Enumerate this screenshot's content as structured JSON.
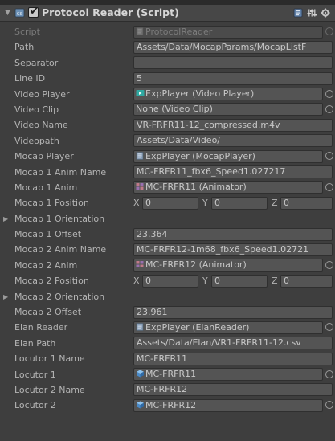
{
  "component": {
    "title": "Protocol Reader (Script)",
    "enabled": true
  },
  "icons": {
    "fold": "triangle-down-icon",
    "script": "script-icon",
    "checkbox": "checkbox-checked-icon",
    "help": "help-book-icon",
    "preset": "preset-icon",
    "settings": "gear-icon",
    "selector": "object-picker-icon",
    "video_component": "video-player-component-icon",
    "script_asset": "script-asset-icon",
    "animator": "animator-icon",
    "gameobject": "gameobject-cube-icon"
  },
  "rows": {
    "script": {
      "label": "Script",
      "value": "ProtocolReader"
    },
    "path": {
      "label": "Path",
      "value": "Assets/Data/MocapParams/MocapListF"
    },
    "separator": {
      "label": "Separator",
      "value": ""
    },
    "line_id": {
      "label": "Line ID",
      "value": "5"
    },
    "video_player": {
      "label": "Video Player",
      "value": "ExpPlayer (Video Player)"
    },
    "video_clip": {
      "label": "Video Clip",
      "value": "None (Video Clip)"
    },
    "video_name": {
      "label": "Video Name",
      "value": "VR-FRFR11-12_compressed.m4v"
    },
    "videopath": {
      "label": "Videopath",
      "value": "Assets/Data/Video/"
    },
    "mocap_player": {
      "label": "Mocap Player",
      "value": "ExpPlayer (MocapPlayer)"
    },
    "mocap1_anim_name": {
      "label": "Mocap 1 Anim Name",
      "value": "MC-FRFR11_fbx6_Speed1.027217"
    },
    "mocap1_anim": {
      "label": "Mocap 1 Anim",
      "value": "MC-FRFR11 (Animator)"
    },
    "mocap1_position": {
      "label": "Mocap 1 Position",
      "x": "0",
      "y": "0",
      "z": "0"
    },
    "mocap1_orientation": {
      "label": "Mocap 1 Orientation"
    },
    "mocap1_offset": {
      "label": "Mocap 1 Offset",
      "value": "23.364"
    },
    "mocap2_anim_name": {
      "label": "Mocap 2 Anim Name",
      "value": "MC-FRFR12-1m68_fbx6_Speed1.02721"
    },
    "mocap2_anim": {
      "label": "Mocap 2 Anim",
      "value": "MC-FRFR12 (Animator)"
    },
    "mocap2_position": {
      "label": "Mocap 2 Position",
      "x": "0",
      "y": "0",
      "z": "0"
    },
    "mocap2_orientation": {
      "label": "Mocap 2 Orientation"
    },
    "mocap2_offset": {
      "label": "Mocap 2 Offset",
      "value": "23.961"
    },
    "elan_reader": {
      "label": "Elan Reader",
      "value": "ExpPlayer (ElanReader)"
    },
    "elan_path": {
      "label": "Elan Path",
      "value": "Assets/Data/Elan/VR1-FRFR11-12.csv"
    },
    "locutor1_name": {
      "label": "Locutor 1 Name",
      "value": "MC-FRFR11"
    },
    "locutor1": {
      "label": "Locutor 1",
      "value": "MC-FRFR11"
    },
    "locutor2_name": {
      "label": "Locutor 2 Name",
      "value": "MC-FRFR12"
    },
    "locutor2": {
      "label": "Locutor 2",
      "value": "MC-FRFR12"
    }
  },
  "axis_labels": {
    "x": "X",
    "y": "Y",
    "z": "Z"
  }
}
